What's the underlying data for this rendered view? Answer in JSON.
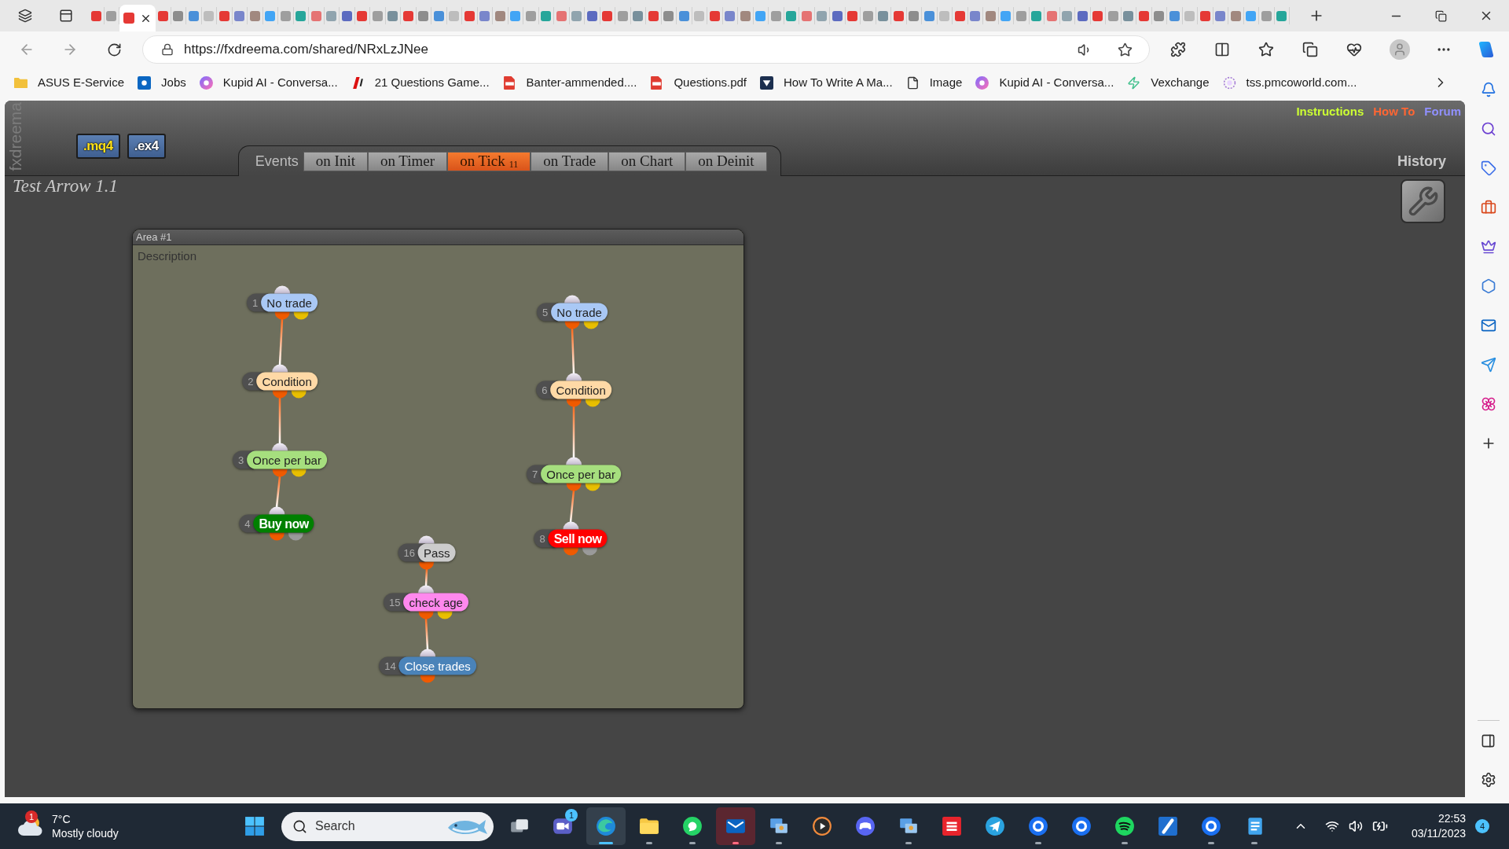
{
  "browser": {
    "tabs": [
      {
        "selected": false
      },
      {
        "selected": false
      },
      {
        "selected": true
      },
      {
        "selected": false
      },
      {
        "selected": false
      },
      {
        "selected": false
      },
      {
        "selected": false
      },
      {
        "selected": false
      },
      {
        "selected": false
      },
      {
        "selected": false
      },
      {
        "selected": false
      },
      {
        "selected": false
      },
      {
        "selected": false
      },
      {
        "selected": false
      },
      {
        "selected": false
      },
      {
        "selected": false
      },
      {
        "selected": false
      },
      {
        "selected": false
      },
      {
        "selected": false
      },
      {
        "selected": false
      },
      {
        "selected": false
      },
      {
        "selected": false
      },
      {
        "selected": false
      },
      {
        "selected": false
      },
      {
        "selected": false
      },
      {
        "selected": false
      },
      {
        "selected": false
      },
      {
        "selected": false
      },
      {
        "selected": false
      },
      {
        "selected": false
      },
      {
        "selected": false
      },
      {
        "selected": false
      },
      {
        "selected": false
      },
      {
        "selected": false
      },
      {
        "selected": false
      },
      {
        "selected": false
      },
      {
        "selected": false
      },
      {
        "selected": false
      },
      {
        "selected": false
      },
      {
        "selected": false
      },
      {
        "selected": false
      },
      {
        "selected": false
      },
      {
        "selected": false
      },
      {
        "selected": false
      },
      {
        "selected": false
      },
      {
        "selected": false
      },
      {
        "selected": false
      },
      {
        "selected": false
      },
      {
        "selected": false
      },
      {
        "selected": false
      },
      {
        "selected": false
      },
      {
        "selected": false
      },
      {
        "selected": false
      },
      {
        "selected": false
      },
      {
        "selected": false
      },
      {
        "selected": false
      },
      {
        "selected": false
      },
      {
        "selected": false
      },
      {
        "selected": false
      },
      {
        "selected": false
      },
      {
        "selected": false
      },
      {
        "selected": false
      },
      {
        "selected": false
      },
      {
        "selected": false
      },
      {
        "selected": false
      },
      {
        "selected": false
      },
      {
        "selected": false
      },
      {
        "selected": false
      },
      {
        "selected": false
      },
      {
        "selected": false
      },
      {
        "selected": false
      },
      {
        "selected": false
      },
      {
        "selected": false
      },
      {
        "selected": false
      },
      {
        "selected": false
      },
      {
        "selected": false
      },
      {
        "selected": false
      }
    ],
    "address": {
      "url": "https://fxdreema.com/shared/NRxLzJNee"
    },
    "bookmarks": [
      "ASUS E-Service",
      "Jobs",
      "Kupid AI - Conversa...",
      "21 Questions Game...",
      "Banter-ammended....",
      "Questions.pdf",
      "How To Write A Ma...",
      "Image",
      "Kupid AI - Conversa...",
      "Vexchange",
      "tss.pmcoworld.com..."
    ]
  },
  "page": {
    "brand": "fxdreema",
    "downloads": [
      ".mq4",
      ".ex4"
    ],
    "links": [
      {
        "label": "Instructions",
        "color": "#ccff33"
      },
      {
        "label": "How To",
        "color": "#ff6633"
      },
      {
        "label": "Forum",
        "color": "#9090ff"
      }
    ],
    "events_label": "Events",
    "event_tabs": [
      {
        "label": "on Init",
        "selected": false
      },
      {
        "label": "on Timer",
        "selected": false
      },
      {
        "label": "on Tick",
        "count": "11",
        "selected": true
      },
      {
        "label": "on Trade",
        "selected": false
      },
      {
        "label": "on Chart",
        "selected": false
      },
      {
        "label": "on Deinit",
        "selected": false
      }
    ],
    "history": "History",
    "project_title": "Test Arrow 1.1",
    "area": {
      "title": "Area #1",
      "description": "Description",
      "flows": [
        {
          "number": "1",
          "label": "No trade",
          "kind": "condition",
          "color": "#a9c8f5",
          "next": [
            {
              "number": "2",
              "label": "Condition",
              "kind": "condition",
              "color": "#ffd9a6",
              "next": [
                {
                  "number": "3",
                  "label": "Once per bar",
                  "kind": "condition",
                  "color": "#a6df7e",
                  "next": [
                    {
                      "number": "4",
                      "label": "Buy now",
                      "kind": "order",
                      "color": "#008000"
                    }
                  ]
                }
              ]
            }
          ]
        },
        {
          "number": "5",
          "label": "No trade",
          "kind": "condition",
          "color": "#a9c8f5",
          "next": [
            {
              "number": "6",
              "label": "Condition",
              "kind": "condition",
              "color": "#ffd9a6",
              "next": [
                {
                  "number": "7",
                  "label": "Once per bar",
                  "kind": "condition",
                  "color": "#a6df7e",
                  "next": [
                    {
                      "number": "8",
                      "label": "Sell now",
                      "kind": "order",
                      "color": "#ff0000"
                    }
                  ]
                }
              ]
            }
          ]
        },
        {
          "number": "16",
          "label": "Pass",
          "kind": "action",
          "color": "#cccccc",
          "next": [
            {
              "number": "15",
              "label": "check age",
              "kind": "condition",
              "color": "#ff88ee",
              "next": [
                {
                  "number": "14",
                  "label": "Close trades",
                  "kind": "action",
                  "color": "#4a83b9"
                }
              ]
            }
          ]
        }
      ]
    }
  },
  "taskbar": {
    "weather": {
      "badge": "1",
      "temperature": "7°C",
      "condition": "Mostly cloudy"
    },
    "search": {
      "placeholder": "Search"
    },
    "apps": [
      {
        "running": false,
        "selected": false,
        "attention": false
      },
      {
        "running": false,
        "selected": false,
        "attention": false,
        "badge": "1"
      },
      {
        "running": true,
        "selected": true,
        "attention": false
      },
      {
        "running": true,
        "selected": false,
        "attention": false
      },
      {
        "running": true,
        "selected": false,
        "attention": false
      },
      {
        "running": true,
        "selected": false,
        "attention": true
      },
      {
        "running": true,
        "selected": false,
        "attention": false
      },
      {
        "running": false,
        "selected": false,
        "attention": false
      },
      {
        "running": false,
        "selected": false,
        "attention": false
      },
      {
        "running": true,
        "selected": false,
        "attention": false
      },
      {
        "running": false,
        "selected": false,
        "attention": false
      },
      {
        "running": false,
        "selected": false,
        "attention": false
      },
      {
        "running": true,
        "selected": false,
        "attention": false
      },
      {
        "running": false,
        "selected": false,
        "attention": false
      },
      {
        "running": true,
        "selected": false,
        "attention": false
      },
      {
        "running": false,
        "selected": false,
        "attention": false
      },
      {
        "running": true,
        "selected": false,
        "attention": false
      },
      {
        "running": true,
        "selected": false,
        "attention": false
      }
    ],
    "clock": {
      "time": "22:53",
      "date": "03/11/2023"
    },
    "notifications": "4"
  }
}
